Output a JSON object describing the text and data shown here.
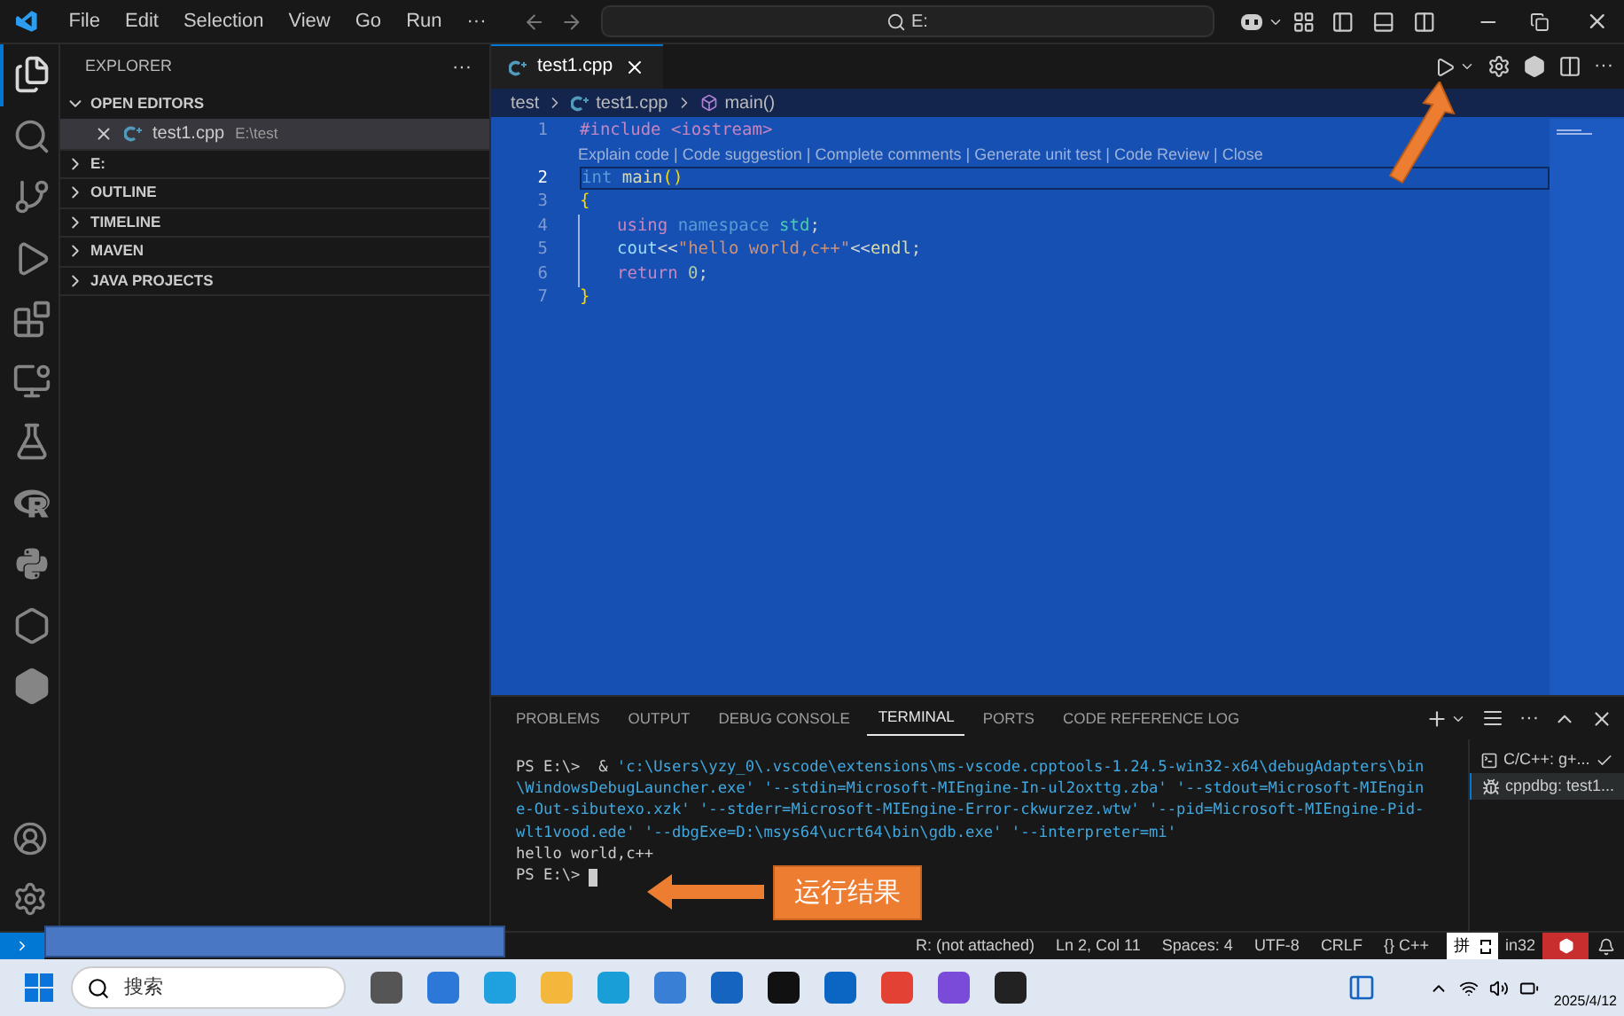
{
  "menu": [
    "File",
    "Edit",
    "Selection",
    "View",
    "Go",
    "Run",
    "···"
  ],
  "command_center": {
    "value": "E:"
  },
  "explorer": {
    "title": "EXPLORER",
    "more": "···",
    "sections": [
      {
        "label": "OPEN EDITORS",
        "expanded": true,
        "items": [
          {
            "name": "test1.cpp",
            "path": "E:\\test",
            "selected": true
          }
        ]
      },
      {
        "label": "E:",
        "expanded": false
      },
      {
        "label": "OUTLINE",
        "expanded": false
      },
      {
        "label": "TIMELINE",
        "expanded": false
      },
      {
        "label": "MAVEN",
        "expanded": false
      },
      {
        "label": "JAVA PROJECTS",
        "expanded": false
      }
    ]
  },
  "activity_bar": [
    {
      "kind": "files",
      "selected": true
    },
    {
      "kind": "search",
      "selected": false
    },
    {
      "kind": "git",
      "selected": false
    },
    {
      "kind": "debug",
      "selected": false
    },
    {
      "kind": "extensions",
      "selected": false
    },
    {
      "kind": "remote",
      "selected": false
    },
    {
      "kind": "flask",
      "selected": false
    },
    {
      "kind": "r",
      "selected": false
    },
    {
      "kind": "python",
      "selected": false
    },
    {
      "kind": "hex",
      "selected": false
    },
    {
      "kind": "hexfill",
      "selected": false
    }
  ],
  "editor_tabs": [
    {
      "label": "test1.cpp",
      "selected": true
    }
  ],
  "breadcrumb": [
    "test",
    "test1.cpp",
    "main()"
  ],
  "code_lens": "Explain code | Code suggestion | Complete comments | Generate unit test | Code Review | Close",
  "code": [
    {
      "number": "1",
      "current": false,
      "tokens": [
        {
          "text": "#include <iostream>",
          "kind": "directive"
        }
      ]
    },
    {
      "number": "2",
      "current": true,
      "tokens": [
        {
          "text": "int",
          "kind": "type"
        },
        {
          "text": " main",
          "kind": "function"
        },
        {
          "text": "()",
          "kind": "bracket"
        }
      ]
    },
    {
      "number": "3",
      "current": false,
      "tokens": [
        {
          "text": "{",
          "kind": "bracket"
        }
      ]
    },
    {
      "number": "4",
      "current": false,
      "indented": true,
      "tokens": [
        {
          "text": "using",
          "kind": "keyword"
        },
        {
          "text": " namespace",
          "kind": "type"
        },
        {
          "text": " std",
          "kind": "namespace"
        },
        {
          "text": ";",
          "kind": "plain"
        }
      ]
    },
    {
      "number": "5",
      "current": false,
      "indented": true,
      "tokens": [
        {
          "text": "cout",
          "kind": "variable"
        },
        {
          "text": "<<",
          "kind": "plain"
        },
        {
          "text": "\"hello world,c++\"",
          "kind": "string"
        },
        {
          "text": "<<",
          "kind": "plain"
        },
        {
          "text": "endl",
          "kind": "function"
        },
        {
          "text": ";",
          "kind": "plain"
        }
      ]
    },
    {
      "number": "6",
      "current": false,
      "indented": true,
      "tokens": [
        {
          "text": "return",
          "kind": "keyword"
        },
        {
          "text": " 0",
          "kind": "number"
        },
        {
          "text": ";",
          "kind": "plain"
        }
      ]
    },
    {
      "number": "7",
      "current": false,
      "tokens": [
        {
          "text": "}",
          "kind": "bracket"
        }
      ]
    }
  ],
  "panel_tabs": [
    {
      "label": "PROBLEMS",
      "selected": false
    },
    {
      "label": "OUTPUT",
      "selected": false
    },
    {
      "label": "DEBUG CONSOLE",
      "selected": false
    },
    {
      "label": "TERMINAL",
      "selected": true
    },
    {
      "label": "PORTS",
      "selected": false
    },
    {
      "label": "CODE REFERENCE LOG",
      "selected": false
    }
  ],
  "terminal": [
    [
      {
        "text": "PS E:\\>  & ",
        "kind": "plain"
      },
      {
        "text": "'c:\\Users\\yzy_0\\.vscode\\extensions\\ms-vscode.cpptools-1.24.5-win32-x64\\debugAdapters\\bin",
        "kind": "path"
      }
    ],
    [
      {
        "text": "\\WindowsDebugLauncher.exe' '--stdin=Microsoft-MIEngine-In-ul2oxttg.zba' '--stdout=Microsoft-MIEngin",
        "kind": "path"
      }
    ],
    [
      {
        "text": "e-Out-sibutexo.xzk' '--stderr=Microsoft-MIEngine-Error-ckwurzez.wtw' '--pid=Microsoft-MIEngine-Pid-",
        "kind": "path"
      }
    ],
    [
      {
        "text": "wlt1vood.ede' '--dbgExe=D:\\msys64\\ucrt64\\bin\\gdb.exe' '--interpreter=mi'",
        "kind": "path"
      }
    ],
    [
      {
        "text": "hello world,c++",
        "kind": "plain"
      }
    ],
    [
      {
        "text": "PS E:\\> ",
        "kind": "plain"
      }
    ]
  ],
  "terminals": [
    {
      "label": "C/C++: g+...",
      "kind": "task",
      "selected": false
    },
    {
      "label": "cppdbg: test1...",
      "kind": "debug",
      "selected": true
    }
  ],
  "callout": "运行结果",
  "status_bar": [
    "R: (not attached)",
    "Ln 2, Col 11",
    "Spaces: 4",
    "UTF-8",
    "CRLF",
    "{} C++"
  ],
  "ime": {
    "label": "拼"
  },
  "status_cut": "in32",
  "taskbar": {
    "search": "搜索",
    "date": "2025/4/12"
  }
}
